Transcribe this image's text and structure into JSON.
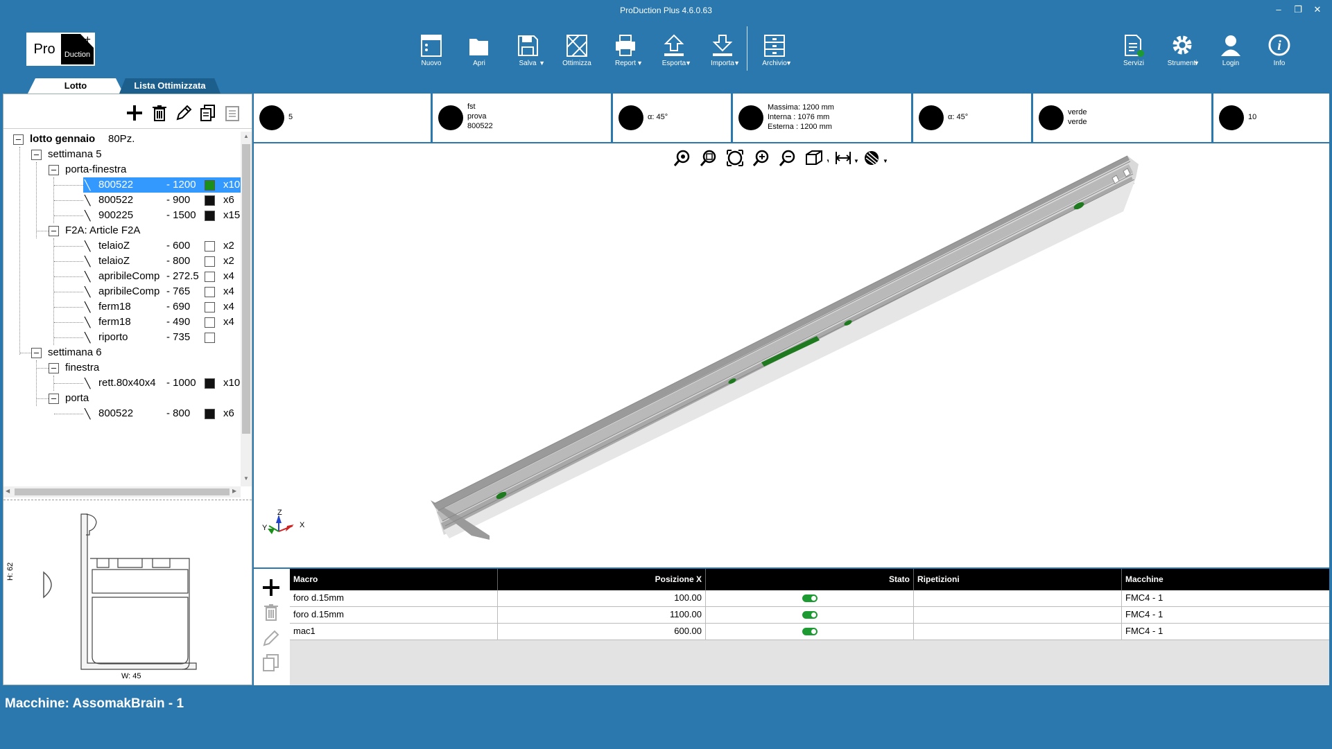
{
  "window": {
    "title": "ProDuction Plus 4.6.0.63"
  },
  "logo": {
    "left": "Pro",
    "right": "Duction",
    "plus": "+"
  },
  "toolbar": {
    "buttons": [
      {
        "label": "Nuovo",
        "caret": false
      },
      {
        "label": "Apri",
        "caret": false
      },
      {
        "label": "Salva",
        "caret": true
      },
      {
        "label": "Ottimizza",
        "caret": false
      },
      {
        "label": "Report",
        "caret": true
      },
      {
        "label": "Esporta",
        "caret": true
      },
      {
        "label": "Importa",
        "caret": true
      },
      {
        "label": "Archivio",
        "caret": true
      }
    ],
    "right_buttons": [
      {
        "label": "Servizi",
        "caret": false
      },
      {
        "label": "Strumenti",
        "caret": true
      },
      {
        "label": "Login",
        "caret": false
      },
      {
        "label": "Info",
        "caret": false
      }
    ]
  },
  "tabs": [
    {
      "label": "Lotto",
      "active": true
    },
    {
      "label": "Lista Ottimizzata",
      "active": false
    }
  ],
  "tree": {
    "root": {
      "name": "lotto gennaio",
      "count": "80Pz."
    },
    "weeks": [
      {
        "name": "settimana 5",
        "groups": [
          {
            "name": "porta-finestra",
            "items": [
              {
                "name": "800522",
                "dim": "- 1200",
                "color": "#1a8f1a",
                "count": "x10",
                "selected": true
              },
              {
                "name": "800522",
                "dim": "- 900",
                "color": "#111111",
                "count": "x6"
              },
              {
                "name": "900225",
                "dim": "- 1500",
                "color": "#111111",
                "count": "x15"
              }
            ]
          },
          {
            "name": "F2A: Article F2A",
            "items": [
              {
                "name": "telaioZ",
                "dim": "- 600",
                "color": "",
                "count": "x2"
              },
              {
                "name": "telaioZ",
                "dim": "- 800",
                "color": "",
                "count": "x2"
              },
              {
                "name": "apribileComp",
                "dim": "- 272.5",
                "color": "",
                "count": "x4"
              },
              {
                "name": "apribileComp",
                "dim": "- 765",
                "color": "",
                "count": "x4"
              },
              {
                "name": "ferm18",
                "dim": "- 690",
                "color": "",
                "count": "x4"
              },
              {
                "name": "ferm18",
                "dim": "- 490",
                "color": "",
                "count": "x4"
              },
              {
                "name": "riporto",
                "dim": "- 735",
                "color": "",
                "count": ""
              }
            ]
          }
        ]
      },
      {
        "name": "settimana 6",
        "groups": [
          {
            "name": "finestra",
            "items": [
              {
                "name": "rett.80x40x4",
                "dim": "- 1000",
                "color": "#111111",
                "count": "x10"
              }
            ]
          },
          {
            "name": "porta",
            "items": [
              {
                "name": "800522",
                "dim": "- 800",
                "color": "#111111",
                "count": "x6"
              }
            ]
          }
        ]
      }
    ]
  },
  "profile": {
    "height_label": "H: 62",
    "width_label": "W: 45"
  },
  "infobar": {
    "qty": "5",
    "article": [
      "fst",
      "prova",
      "800522"
    ],
    "angle_left": "α: 45°",
    "lengths": [
      "Massima: 1200 mm",
      "Interna   : 1076 mm",
      "Esterna   : 1200 mm"
    ],
    "angle_right": "α: 45°",
    "colors": [
      "verde",
      "verde"
    ],
    "stack": "10"
  },
  "axes": {
    "x": "X",
    "y": "Y",
    "z": "Z"
  },
  "grid": {
    "headers": [
      "Macro",
      "Posizione X",
      "Stato",
      "Ripetizioni",
      "Macchine"
    ],
    "rows": [
      {
        "macro": "foro d.15mm",
        "pos": "100.00",
        "stato": true,
        "rip": "",
        "mac": "FMC4 - 1"
      },
      {
        "macro": "foro d.15mm",
        "pos": "1100.00",
        "stato": true,
        "rip": "",
        "mac": "FMC4 - 1"
      },
      {
        "macro": "mac1",
        "pos": "600.00",
        "stato": true,
        "rip": "",
        "mac": "FMC4 - 1"
      }
    ]
  },
  "status": {
    "label": "Macchine:",
    "value": "AssomakBrain - 1"
  }
}
